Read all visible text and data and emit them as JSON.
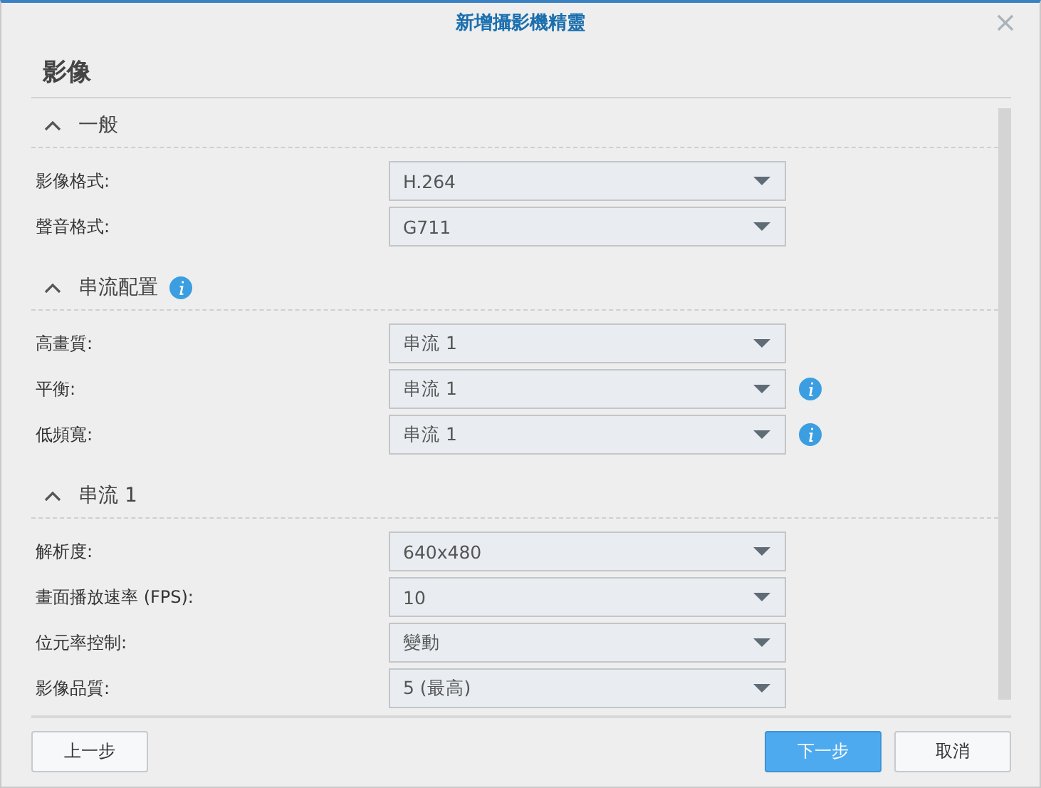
{
  "window": {
    "title": "新增攝影機精靈"
  },
  "heading": "影像",
  "sections": [
    {
      "title": "一般",
      "expanded": true,
      "info": false,
      "fields": [
        {
          "label": "影像格式:",
          "value": "H.264",
          "info": false
        },
        {
          "label": "聲音格式:",
          "value": "G711",
          "info": false
        }
      ]
    },
    {
      "title": "串流配置",
      "expanded": true,
      "info": true,
      "fields": [
        {
          "label": "高畫質:",
          "value": "串流 1",
          "info": false
        },
        {
          "label": "平衡:",
          "value": "串流 1",
          "info": true
        },
        {
          "label": "低頻寬:",
          "value": "串流 1",
          "info": true
        }
      ]
    },
    {
      "title": "串流 1",
      "expanded": true,
      "info": false,
      "fields": [
        {
          "label": "解析度:",
          "value": "640x480",
          "info": false
        },
        {
          "label": "畫面播放速率 (FPS):",
          "value": "10",
          "info": false
        },
        {
          "label": "位元率控制:",
          "value": "變動",
          "info": false
        },
        {
          "label": "影像品質:",
          "value": "5 (最高)",
          "info": false
        }
      ]
    }
  ],
  "buttons": [
    {
      "label": "上一步",
      "kind": "default"
    },
    {
      "label": "下一步",
      "kind": "primary"
    },
    {
      "label": "取消",
      "kind": "default"
    }
  ]
}
